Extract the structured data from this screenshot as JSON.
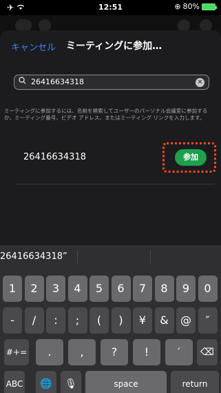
{
  "status_bar": {
    "airplane_icon": "airplane-icon",
    "wifi_icon": "wifi-icon",
    "time": "12:51",
    "battery_percent": "80%"
  },
  "nav": {
    "cancel_label": "キャンセル",
    "title": "ミーティングに参加…"
  },
  "search": {
    "value": "26416634318"
  },
  "hint": "ミーティングに参加するには、名前を検索してユーザーのパーソナル会議室に参加するか、ミーティング番号、ビデオ アドレス、またはミーティング リンクを入力します。",
  "result": {
    "number": "26416634318",
    "join_label": "参加",
    "highlight_color": "#ff4a1c",
    "join_color": "#1f9e4d"
  },
  "keyboard": {
    "suggestion": "26416634318”",
    "row1": [
      "1",
      "2",
      "3",
      "4",
      "5",
      "6",
      "7",
      "8",
      "9",
      "0"
    ],
    "row2": [
      "-",
      "/",
      ":",
      ";",
      "(",
      ")",
      "¥",
      "&",
      "@",
      "″"
    ],
    "row3_mode": "#+=",
    "row3": [
      ".",
      ",",
      "?",
      "!",
      "′"
    ],
    "abc_label": "ABC",
    "space_label": "space",
    "return_label": "return"
  }
}
